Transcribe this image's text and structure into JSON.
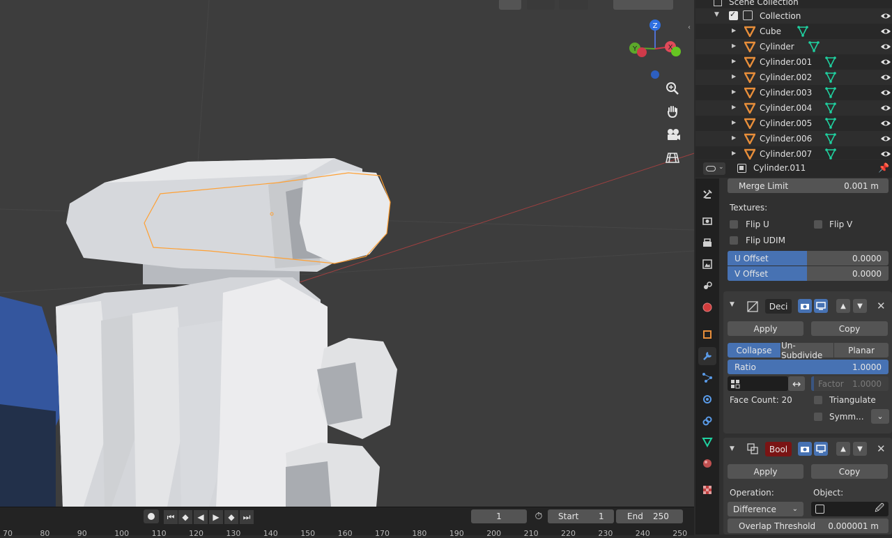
{
  "colors": {
    "accent": "#4772b3",
    "selection": "#ffa033",
    "mesh_icon": "#1fd1a0",
    "object_icon": "#e88e3a",
    "boolean_bg": "#7a1414"
  },
  "viewport": {
    "nav_icons": [
      "zoom-icon",
      "hand-pan-icon",
      "camera-icon",
      "grid-view-icon"
    ],
    "gizmo": {
      "z": "Z",
      "y": "Y",
      "x": "X"
    }
  },
  "timeline": {
    "current_frame": "1",
    "start_label": "Start",
    "start_value": "1",
    "end_label": "End",
    "end_value": "250",
    "ruler": [
      "70",
      "80",
      "90",
      "100",
      "110",
      "120",
      "130",
      "140",
      "150",
      "160",
      "170",
      "180",
      "190",
      "200",
      "210",
      "220",
      "230",
      "240",
      "250"
    ]
  },
  "outliner": {
    "scene_collection": "Scene Collection",
    "collection": "Collection",
    "items": [
      "Cube",
      "Cylinder",
      "Cylinder.001",
      "Cylinder.002",
      "Cylinder.003",
      "Cylinder.004",
      "Cylinder.005",
      "Cylinder.006",
      "Cylinder.007"
    ]
  },
  "properties": {
    "object_name": "Cylinder.011",
    "merge_limit_label": "Merge Limit",
    "merge_limit_value": "0.001 m",
    "textures_label": "Textures:",
    "flip_u": "Flip U",
    "flip_v": "Flip V",
    "flip_udim": "Flip UDIM",
    "u_offset_label": "U Offset",
    "u_offset_value": "0.0000",
    "v_offset_label": "V Offset",
    "v_offset_value": "0.0000",
    "decimate": {
      "name": "Deci",
      "apply": "Apply",
      "copy": "Copy",
      "modes": [
        "Collapse",
        "Un-Subdivide",
        "Planar"
      ],
      "ratio_label": "Ratio",
      "ratio_value": "1.0000",
      "factor_label": "Factor",
      "factor_value": "1.0000",
      "face_count": "Face Count: 20",
      "triangulate": "Triangulate",
      "symmetry": "Symm..."
    },
    "boolean": {
      "name": "Bool",
      "apply": "Apply",
      "copy": "Copy",
      "operation_label": "Operation:",
      "object_label": "Object:",
      "operation_value": "Difference",
      "overlap_label": "Overlap Threshold",
      "overlap_value": "0.000001 m"
    }
  }
}
